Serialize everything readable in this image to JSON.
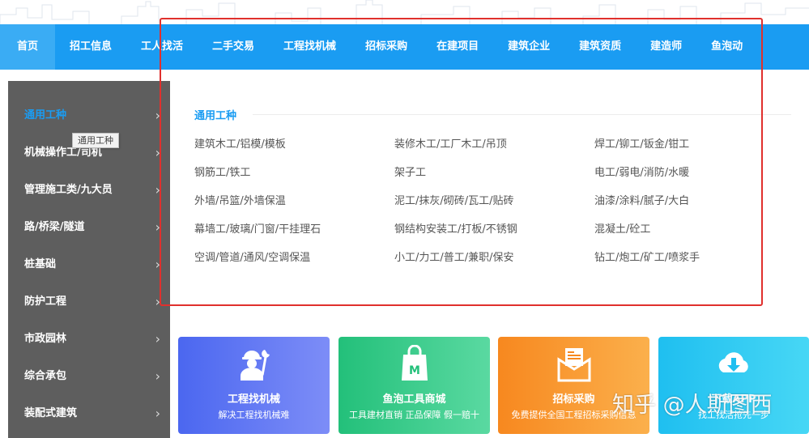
{
  "nav": {
    "items": [
      {
        "label": "首页",
        "active": true
      },
      {
        "label": "招工信息"
      },
      {
        "label": "工人找活"
      },
      {
        "label": "二手交易"
      },
      {
        "label": "工程找机械"
      },
      {
        "label": "招标采购"
      },
      {
        "label": "在建项目"
      },
      {
        "label": "建筑企业"
      },
      {
        "label": "建筑资质"
      },
      {
        "label": "建造师"
      },
      {
        "label": "鱼泡动"
      }
    ]
  },
  "sidebar": {
    "items": [
      {
        "label": "通用工种",
        "active": true
      },
      {
        "label": "机械操作工/司机"
      },
      {
        "label": "管理施工类/九大员"
      },
      {
        "label": "路/桥梁/隧道"
      },
      {
        "label": "桩基础"
      },
      {
        "label": "防护工程"
      },
      {
        "label": "市政园林"
      },
      {
        "label": "综合承包"
      },
      {
        "label": "装配式建筑"
      }
    ],
    "chevron": "›",
    "tooltip": "通用工种"
  },
  "panel": {
    "title": "通用工种",
    "items": [
      "建筑木工/铝模/模板",
      "装修木工/工厂木工/吊顶",
      "焊工/铆工/钣金/钳工",
      "钢筋工/铁工",
      "架子工",
      "电工/弱电/消防/水暖",
      "外墙/吊篮/外墙保温",
      "泥工/抹灰/砌砖/瓦工/贴砖",
      "油漆/涂料/腻子/大白",
      "幕墙工/玻璃/门窗/干挂理石",
      "钢结构安装工/打板/不锈钢",
      "混凝土/砼工",
      "空调/管道/通风/空调保温",
      "小工/力工/普工/兼职/保安",
      "钻工/炮工/矿工/喷浆手"
    ]
  },
  "cards": [
    {
      "title": "工程找机械",
      "subtitle": "解决工程找机械难",
      "icon": "worker-wrench-icon"
    },
    {
      "title": "鱼泡工具商城",
      "subtitle": "工具建材直销 正品保障 假一赔十",
      "icon": "shopping-bag-icon"
    },
    {
      "title": "招标采购",
      "subtitle": "免费提供全国工程招标采购信息",
      "icon": "envelope-document-icon"
    },
    {
      "title": "下载APP",
      "subtitle": "找工找活抢先一步",
      "icon": "cloud-download-icon"
    }
  ],
  "watermark": "知乎 @人斯图西",
  "colors": {
    "nav_blue": "#1a9cf2",
    "sidebar_gray": "#5e5e5e",
    "annotation_red": "#e0302d"
  }
}
